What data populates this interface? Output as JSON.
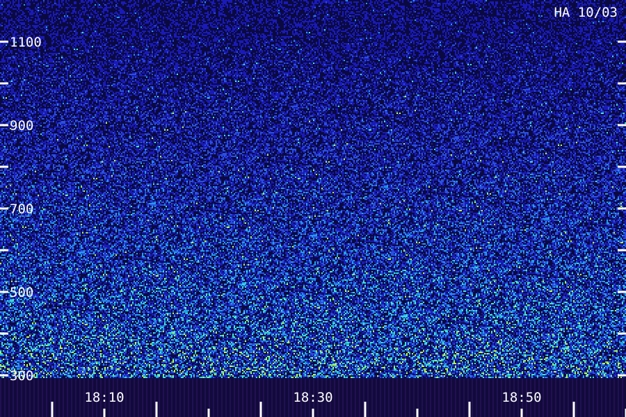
{
  "chart_data": {
    "type": "heatmap",
    "title": "",
    "station_tag": "HA 10/03",
    "xlabel": "",
    "ylabel": "",
    "x_ticks": [
      "18:10",
      "18:30",
      "18:50"
    ],
    "y_ticks": [
      "300",
      "500",
      "700",
      "900",
      "1100"
    ],
    "y_tick_values": [
      300,
      500,
      700,
      900,
      1100
    ],
    "ylim": [
      300,
      1200
    ],
    "xlim_minutes": [
      18.0,
      19.0
    ],
    "grid": false,
    "legend": "none",
    "colormap": [
      "#0a0a40",
      "#1a1ab8",
      "#2a50e0",
      "#20a0e8",
      "#40e8c8",
      "#c0ff40"
    ],
    "background": "#0b0b52"
  }
}
